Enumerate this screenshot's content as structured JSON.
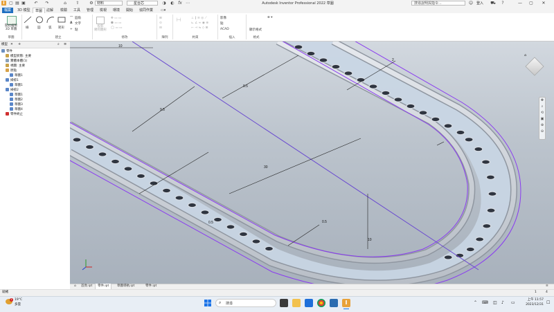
{
  "app": {
    "logo": "I",
    "window_title": "Autodesk Inventor Professional 2022   草圖",
    "doc_select": "材料",
    "mat_select": "星台芯",
    "search_placeholder": "搜尋說明與指令...",
    "login": "登入",
    "win_min": "—",
    "win_max": "▢",
    "win_close": "✕"
  },
  "ribbon_tabs": [
    "檔案",
    "3D 模型",
    "草圖",
    "註解",
    "檢驗",
    "工具",
    "管理",
    "檢視",
    "環境",
    "開始",
    "協同作業"
  ],
  "active_tab_index": 2,
  "ribbon": {
    "start_sketch": "開始繪製\n3D 草圖",
    "group_sketch": "草圖",
    "create_items": [
      "線",
      "圓",
      "弧",
      "矩形"
    ],
    "fillet": "圓角",
    "text": "文字",
    "point": "點",
    "group_create": "建立",
    "project": "投影\n幾何圖形",
    "group_modify": "修改",
    "group_pattern": "陣列",
    "group_constrain": "約束",
    "insert_image": "影像",
    "insert_points": "點",
    "insert_acad": "ACAD",
    "group_insert": "插入",
    "display_format": "顯示格式",
    "group_format": "格式"
  },
  "browser": {
    "tab": "模型",
    "items": [
      {
        "label": "零件",
        "color": "#6b8fbf",
        "indent": 0
      },
      {
        "label": "模型狀態: 主要",
        "color": "#c9a34a",
        "indent": 1
      },
      {
        "label": "實體本體(1)",
        "color": "#8aa0b8",
        "indent": 1
      },
      {
        "label": "視圖: 主要",
        "color": "#c9a34a",
        "indent": 1
      },
      {
        "label": "原點",
        "color": "#d6a24a",
        "indent": 1
      },
      {
        "label": "草圖1",
        "color": "#5a86c8",
        "indent": 2
      },
      {
        "label": "掃掠1",
        "color": "#5a86c8",
        "indent": 1
      },
      {
        "label": "草圖1",
        "color": "#5a86c8",
        "indent": 2
      },
      {
        "label": "掃掠2",
        "color": "#5a86c8",
        "indent": 1
      },
      {
        "label": "草圖1",
        "color": "#5a86c8",
        "indent": 2
      },
      {
        "label": "草圖2",
        "color": "#5a86c8",
        "indent": 2
      },
      {
        "label": "草圖3",
        "color": "#5a86c8",
        "indent": 2
      },
      {
        "label": "草圖4",
        "color": "#5a86c8",
        "indent": 2
      },
      {
        "label": "零件終止",
        "color": "#d03030",
        "indent": 1
      }
    ]
  },
  "dimensions": [
    "10",
    "9.5",
    "2",
    "9.5",
    "30",
    "0.5",
    "0.5",
    "10"
  ],
  "doc_tabs": [
    "首頁.ipt",
    "零件.ipt",
    "草圖導軌.ipt",
    "零件.ipt"
  ],
  "active_doc_tab": 1,
  "status": {
    "left": "就緒",
    "count1": "1",
    "count2": "4"
  },
  "taskbar": {
    "weather_temp": "19°C",
    "weather_text": "多雲",
    "search": "搜尋",
    "time": "上午 11:57",
    "date": "2023/12/31"
  }
}
